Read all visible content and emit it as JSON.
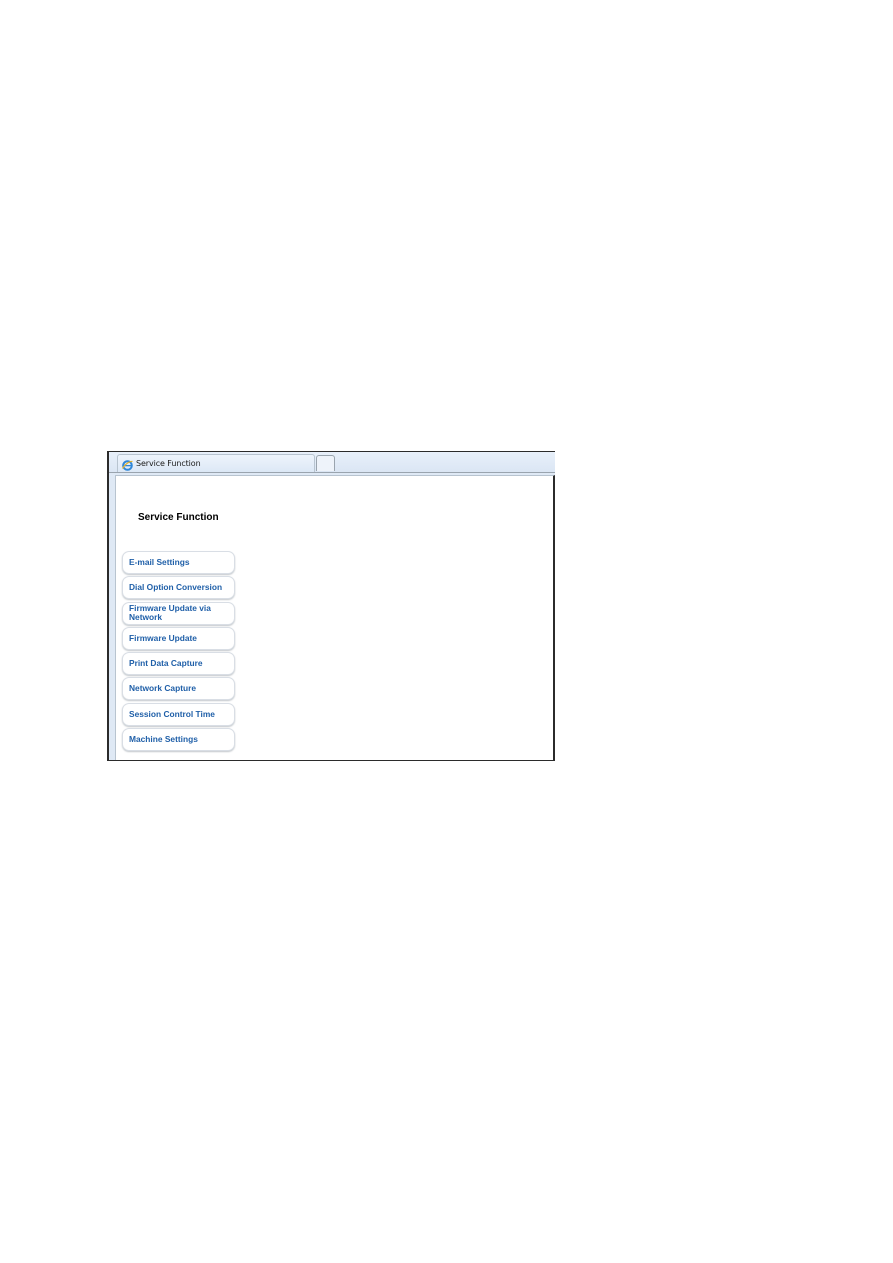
{
  "browser": {
    "tab_title": "Service Function",
    "tab_icon": "internet-explorer-icon",
    "new_tab_icon": "new-tab-icon"
  },
  "page": {
    "title": "Service Function"
  },
  "menu": {
    "items": [
      {
        "label": "E-mail Settings"
      },
      {
        "label": "Dial Option Conversion"
      },
      {
        "label": "Firmware Update via Network"
      },
      {
        "label": "Firmware Update"
      },
      {
        "label": "Print Data Capture"
      },
      {
        "label": "Network Capture"
      },
      {
        "label": "Session Control Time"
      },
      {
        "label": "Machine Settings"
      }
    ]
  },
  "colors": {
    "menu_text": "#1f5fa8",
    "title_text": "#000000",
    "tabbar_bg": "#dfe9f5"
  }
}
